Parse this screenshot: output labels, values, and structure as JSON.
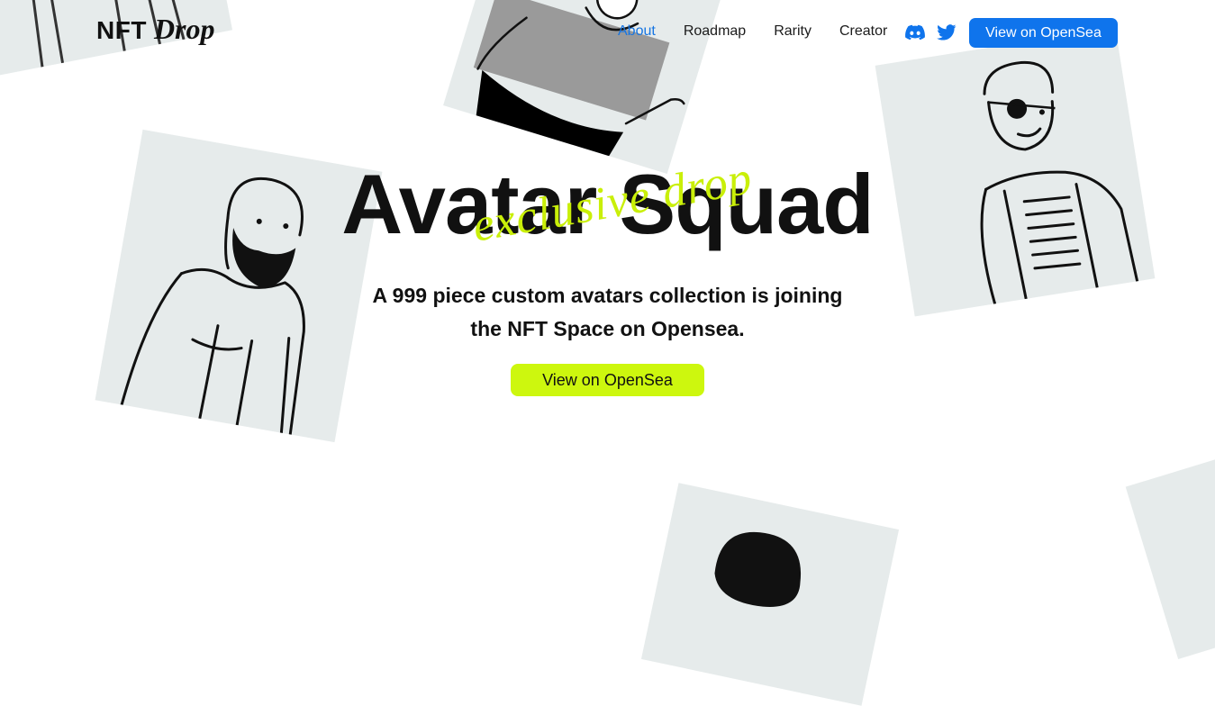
{
  "brand": {
    "name_prefix": "NFT",
    "name_suffix": "Drop"
  },
  "nav": {
    "links": [
      {
        "label": "About",
        "active": true
      },
      {
        "label": "Roadmap",
        "active": false
      },
      {
        "label": "Rarity",
        "active": false
      },
      {
        "label": "Creator",
        "active": false
      }
    ],
    "social_icons": [
      "discord-icon",
      "twitter-icon"
    ],
    "cta_label": "View on OpenSea"
  },
  "hero": {
    "title": "Avatar Squad",
    "script_overlay": "exclusive drop",
    "subtitle": "A 999 piece custom avatars collection is joining the NFT Space on Opensea.",
    "cta_label": "View on OpenSea"
  },
  "colors": {
    "primary_blue": "#0f74ec",
    "accent_lime": "#cdf70e",
    "card_gray": "#e6ebeb",
    "text_dark": "#111111"
  }
}
